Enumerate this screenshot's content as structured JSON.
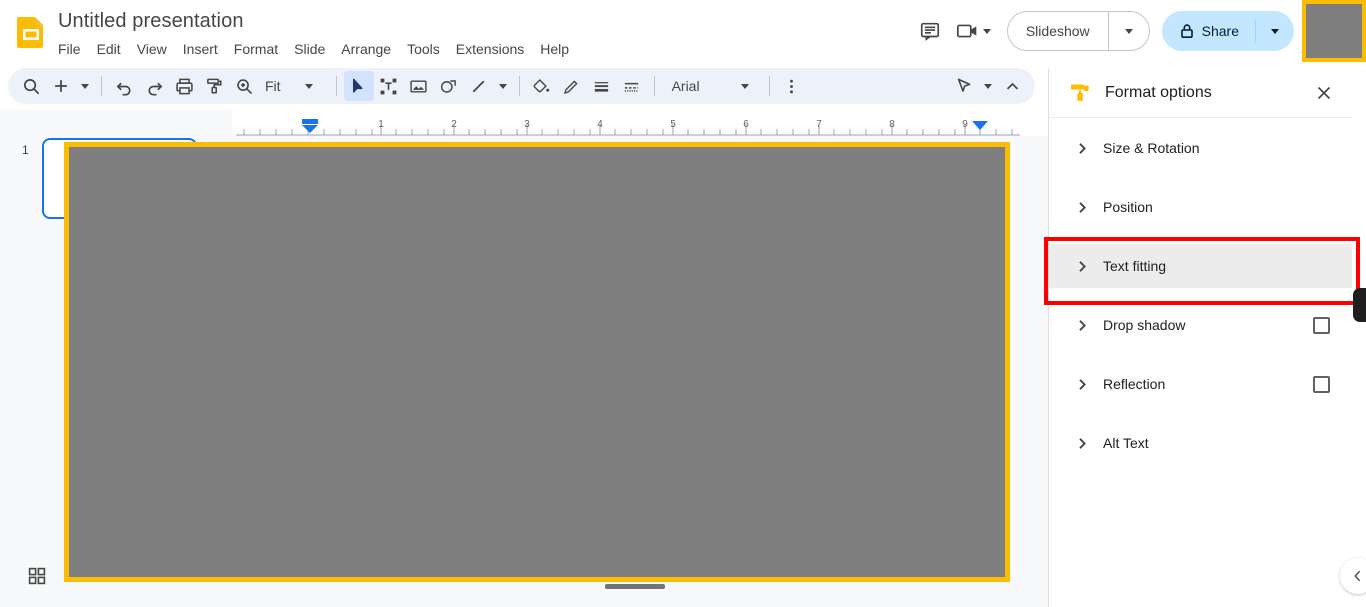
{
  "app": {
    "name": "Google Slides",
    "doc_title": "Untitled presentation",
    "accent_color": "#fbbc04",
    "highlight_color": "#ff0000",
    "share_bg": "#c2e7ff",
    "toolbar_bg": "#edf2fa",
    "slide_fill": "#7e7e7e"
  },
  "menubar": {
    "items": [
      {
        "label": "File"
      },
      {
        "label": "Edit"
      },
      {
        "label": "View"
      },
      {
        "label": "Insert"
      },
      {
        "label": "Format"
      },
      {
        "label": "Slide"
      },
      {
        "label": "Arrange"
      },
      {
        "label": "Tools"
      },
      {
        "label": "Extensions"
      },
      {
        "label": "Help"
      }
    ]
  },
  "header_right": {
    "comment_icon": "comment-history-icon",
    "meet_icon": "video-camera-icon",
    "slideshow_label": "Slideshow",
    "share_label": "Share",
    "share_icon": "lock-icon"
  },
  "toolbar": {
    "items": [
      {
        "name": "search",
        "icon": "search-icon"
      },
      {
        "name": "new-slide",
        "icon": "plus-icon"
      },
      {
        "name": "new-slide-options",
        "icon": "chevron-down-icon"
      },
      {
        "name": "undo",
        "icon": "undo-icon"
      },
      {
        "name": "redo",
        "icon": "redo-icon"
      },
      {
        "name": "print",
        "icon": "print-icon"
      },
      {
        "name": "paint-format",
        "icon": "paint-format-icon"
      },
      {
        "name": "zoom",
        "icon": "zoom-icon"
      }
    ],
    "zoom_value": "Fit",
    "font_value": "Arial",
    "select_tool": "cursor-arrow-icon",
    "textbox_tool": "text-box-icon",
    "image_tool": "image-icon",
    "shape_tool": "shape-icon",
    "line_tool": "line-icon",
    "fill_tool": "fill-color-icon",
    "border_tool": "border-color-icon",
    "border_weight_tool": "border-weight-icon",
    "border_dash_tool": "border-dash-icon",
    "more_tool": "more-vertical-icon",
    "laser_tool": "laser-pointer-icon",
    "collapse_tool": "chevron-up-icon"
  },
  "ruler": {
    "unit": "inches",
    "ticks": [
      "1",
      "2",
      "3",
      "4",
      "5",
      "6",
      "7",
      "8",
      "9"
    ],
    "left_indent_marker": 0.35,
    "right_indent_marker": 9.1
  },
  "filmstrip": {
    "slide_number": "1",
    "grid_view_icon": "grid-view-icon"
  },
  "panel": {
    "icon": "paint-roller-icon",
    "title": "Format options",
    "close_icon": "close-icon",
    "options": [
      {
        "label": "Size & Rotation",
        "icon": "chevron-right-icon",
        "has_checkbox": false,
        "highlighted": false,
        "checked": false
      },
      {
        "label": "Position",
        "icon": "chevron-right-icon",
        "has_checkbox": false,
        "highlighted": false,
        "checked": false
      },
      {
        "label": "Text fitting",
        "icon": "chevron-right-icon",
        "has_checkbox": false,
        "highlighted": true,
        "checked": false
      },
      {
        "label": "Drop shadow",
        "icon": "chevron-right-icon",
        "has_checkbox": true,
        "highlighted": false,
        "checked": false
      },
      {
        "label": "Reflection",
        "icon": "chevron-right-icon",
        "has_checkbox": true,
        "highlighted": false,
        "checked": false
      },
      {
        "label": "Alt Text",
        "icon": "chevron-right-icon",
        "has_checkbox": false,
        "highlighted": false,
        "checked": false
      }
    ],
    "collapse_icon": "chevron-left-icon"
  }
}
